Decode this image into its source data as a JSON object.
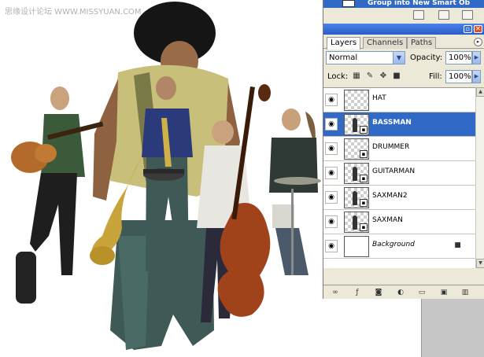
{
  "watermark": "思缘设计论坛 WWW.MISSYUAN.COM",
  "history": {
    "visible_step": "Group into New Smart Ob",
    "icons": [
      "camera-icon",
      "new-doc-icon",
      "trash-icon"
    ]
  },
  "panel": {
    "tabs": [
      {
        "label": "Layers",
        "active": true
      },
      {
        "label": "Channels",
        "active": false
      },
      {
        "label": "Paths",
        "active": false
      }
    ],
    "blend_mode": "Normal",
    "opacity_label": "Opacity:",
    "opacity_value": "100%",
    "lock_label": "Lock:",
    "fill_label": "Fill:",
    "fill_value": "100%",
    "layers": [
      {
        "name": "HAT",
        "selected": false,
        "italic": false,
        "locked": false
      },
      {
        "name": "BASSMAN",
        "selected": true,
        "italic": false,
        "locked": false
      },
      {
        "name": "DRUMMER",
        "selected": false,
        "italic": false,
        "locked": false
      },
      {
        "name": "GUITARMAN",
        "selected": false,
        "italic": false,
        "locked": false
      },
      {
        "name": "SAXMAN2",
        "selected": false,
        "italic": false,
        "locked": false
      },
      {
        "name": "SAXMAN",
        "selected": false,
        "italic": false,
        "locked": false
      },
      {
        "name": "Background",
        "selected": false,
        "italic": true,
        "locked": true
      }
    ],
    "footer_icons": [
      "link-icon",
      "fx-icon",
      "mask-icon",
      "adjustment-icon",
      "folder-icon",
      "new-layer-icon",
      "trash-icon"
    ]
  }
}
